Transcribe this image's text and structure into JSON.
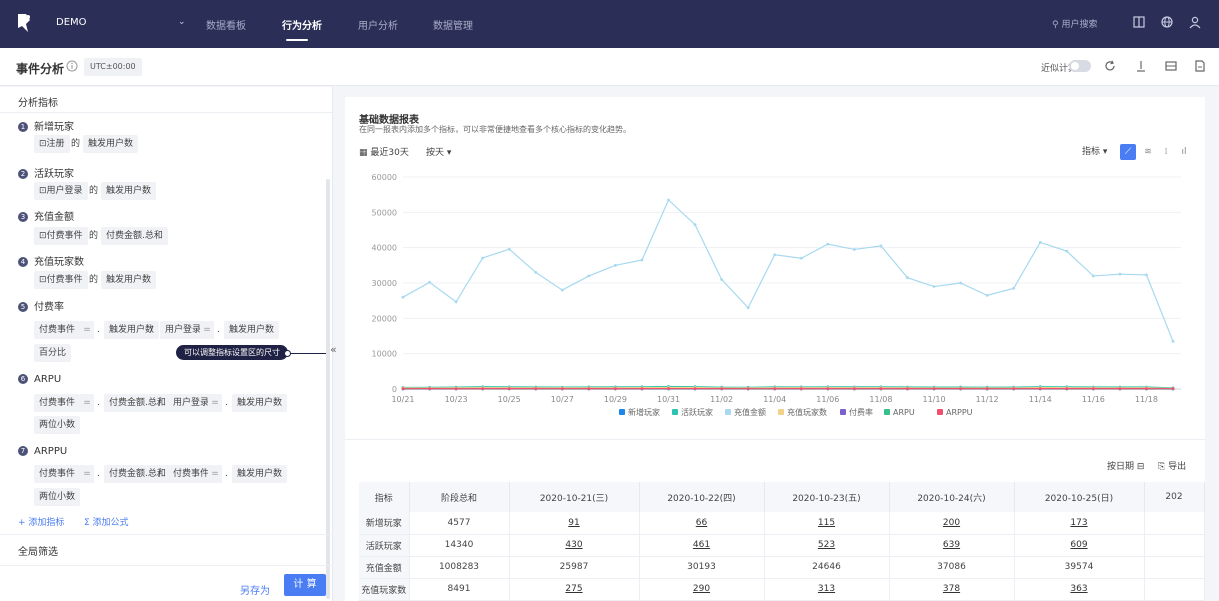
{
  "nav": {
    "project": "DEMO",
    "items": [
      {
        "label": "数据看板",
        "active": false
      },
      {
        "label": "行为分析",
        "active": true
      },
      {
        "label": "用户分析",
        "active": false
      },
      {
        "label": "数据管理",
        "active": false
      }
    ],
    "search_placeholder": "用户搜索"
  },
  "header": {
    "title": "事件分析",
    "timezone": "UTC±00:00",
    "approx_label": "近似计算"
  },
  "left": {
    "section_title": "分析指标",
    "metrics": [
      {
        "num": "1",
        "name": "新增玩家",
        "event": "注册",
        "of": "的",
        "measure": "触发用户数"
      },
      {
        "num": "2",
        "name": "活跃玩家",
        "event": "用户登录",
        "of": "的",
        "measure": "触发用户数"
      },
      {
        "num": "3",
        "name": "充值金额",
        "event": "付费事件",
        "of": "的",
        "measure": "付费金额.总和"
      },
      {
        "num": "4",
        "name": "充值玩家数",
        "event": "付费事件",
        "of": "的",
        "measure": "触发用户数"
      }
    ],
    "formulas": [
      {
        "num": "5",
        "name": "付费率",
        "a_event": "付费事件",
        "a_measure": "触发用户数",
        "b_event": "用户登录",
        "b_measure": "触发用户数",
        "format": "百分比"
      },
      {
        "num": "6",
        "name": "ARPU",
        "a_event": "付费事件",
        "a_measure": "付费金额.总和",
        "b_event": "用户登录",
        "b_measure": "触发用户数",
        "format": "两位小数"
      },
      {
        "num": "7",
        "name": "ARPPU",
        "a_event": "付费事件",
        "a_measure": "付费金额.总和",
        "b_event": "付费事件",
        "b_measure": "触发用户数",
        "format": "两位小数"
      }
    ],
    "eq_symbol": "=",
    "dot": ".",
    "slash": "/",
    "tooltip": "可以调整指标设置区的尺寸",
    "add_metric": "+ 添加指标",
    "add_formula": "Σ 添加公式",
    "global_filter": "全局筛选",
    "save_as": "另存为",
    "calc": "计 算"
  },
  "card": {
    "title": "基础数据报表",
    "subtitle": "在同一报表内添加多个指标，可以非常便捷地查看多个核心指标的变化趋势。",
    "date_range": "最近30天",
    "granularity": "按天",
    "metric_select": "指标",
    "by_date": "按日期",
    "export": "导出"
  },
  "chart_data": {
    "type": "line",
    "x": [
      "10/21",
      "10/22",
      "10/23",
      "10/24",
      "10/25",
      "10/26",
      "10/27",
      "10/28",
      "10/29",
      "10/30",
      "10/31",
      "11/01",
      "11/02",
      "11/03",
      "11/04",
      "11/05",
      "11/06",
      "11/07",
      "11/08",
      "11/09",
      "11/10",
      "11/11",
      "11/12",
      "11/13",
      "11/14",
      "11/15",
      "11/16",
      "11/17",
      "11/18",
      "11/19"
    ],
    "x_ticks": [
      "10/21",
      "10/23",
      "10/25",
      "10/27",
      "10/29",
      "10/31",
      "11/02",
      "11/04",
      "11/06",
      "11/08",
      "11/10",
      "11/12",
      "11/14",
      "11/16",
      "11/18"
    ],
    "ylim": [
      0,
      60000
    ],
    "y_ticks": [
      "0",
      "10000",
      "20000",
      "30000",
      "40000",
      "50000",
      "60000"
    ],
    "grid": true,
    "legend_position": "bottom",
    "series": [
      {
        "name": "新增玩家",
        "color": "#1f87e8",
        "values": [
          91,
          66,
          115,
          200,
          173,
          150,
          160,
          170,
          180,
          190,
          230,
          210,
          140,
          120,
          180,
          170,
          190,
          180,
          185,
          160,
          150,
          155,
          140,
          150,
          200,
          190,
          160,
          165,
          160,
          70
        ]
      },
      {
        "name": "活跃玩家",
        "color": "#2cc4b1",
        "values": [
          430,
          461,
          523,
          639,
          609,
          560,
          540,
          580,
          600,
          620,
          700,
          650,
          520,
          480,
          600,
          590,
          620,
          610,
          615,
          560,
          540,
          545,
          520,
          530,
          650,
          620,
          560,
          565,
          560,
          300
        ]
      },
      {
        "name": "充值金额",
        "color": "#a6d9ef",
        "values": [
          25987,
          30193,
          24646,
          37086,
          39574,
          33000,
          28000,
          32000,
          35000,
          36500,
          53500,
          46500,
          31000,
          23000,
          38000,
          37000,
          41000,
          39500,
          40500,
          31500,
          29000,
          30000,
          26500,
          28500,
          41500,
          39000,
          32000,
          32500,
          32300,
          13500
        ]
      },
      {
        "name": "充值玩家数",
        "color": "#f3d08b",
        "values": [
          275,
          290,
          313,
          378,
          363,
          340,
          320,
          330,
          345,
          350,
          420,
          400,
          300,
          280,
          360,
          355,
          370,
          365,
          368,
          320,
          300,
          305,
          290,
          300,
          380,
          360,
          330,
          332,
          330,
          150
        ]
      },
      {
        "name": "付费率",
        "color": "#7b61c9",
        "values": [
          0.64,
          0.63,
          0.6,
          0.59,
          0.6,
          0.61,
          0.59,
          0.57,
          0.58,
          0.56,
          0.6,
          0.62,
          0.58,
          0.58,
          0.6,
          0.6,
          0.6,
          0.6,
          0.6,
          0.57,
          0.56,
          0.56,
          0.56,
          0.57,
          0.58,
          0.58,
          0.59,
          0.59,
          0.59,
          0.5
        ]
      },
      {
        "name": "ARPU",
        "color": "#36c08a",
        "values": [
          60.4,
          65.5,
          47.1,
          58.0,
          65.0,
          58.9,
          51.9,
          55.2,
          58.3,
          58.9,
          76.4,
          71.5,
          59.6,
          47.9,
          63.3,
          62.7,
          66.1,
          64.8,
          65.9,
          56.3,
          53.7,
          55.0,
          51.0,
          53.8,
          63.8,
          62.9,
          57.1,
          57.5,
          57.7,
          45.0
        ]
      },
      {
        "name": "ARPPU",
        "color": "#f0506e",
        "values": [
          94.5,
          104.1,
          78.7,
          98.1,
          109.0,
          97.1,
          87.5,
          97.0,
          101.4,
          104.3,
          127.4,
          116.3,
          103.3,
          82.1,
          105.6,
          104.2,
          110.8,
          108.2,
          110.1,
          98.4,
          96.7,
          98.4,
          91.4,
          95.0,
          109.2,
          108.3,
          97.0,
          97.9,
          97.9,
          90.0
        ]
      }
    ]
  },
  "table": {
    "headers": [
      "指标",
      "阶段总和",
      "2020-10-21(三)",
      "2020-10-22(四)",
      "2020-10-23(五)",
      "2020-10-24(六)",
      "2020-10-25(日)",
      "202"
    ],
    "rows": [
      {
        "name": "新增玩家",
        "total": "4577",
        "cells": [
          "91",
          "66",
          "115",
          "200",
          "173"
        ],
        "link": true
      },
      {
        "name": "活跃玩家",
        "total": "14340",
        "cells": [
          "430",
          "461",
          "523",
          "639",
          "609"
        ],
        "link": true
      },
      {
        "name": "充值金额",
        "total": "1008283",
        "cells": [
          "25987",
          "30193",
          "24646",
          "37086",
          "39574"
        ],
        "link": false
      },
      {
        "name": "充值玩家数",
        "total": "8491",
        "cells": [
          "275",
          "290",
          "313",
          "378",
          "363"
        ],
        "link": true
      }
    ]
  }
}
